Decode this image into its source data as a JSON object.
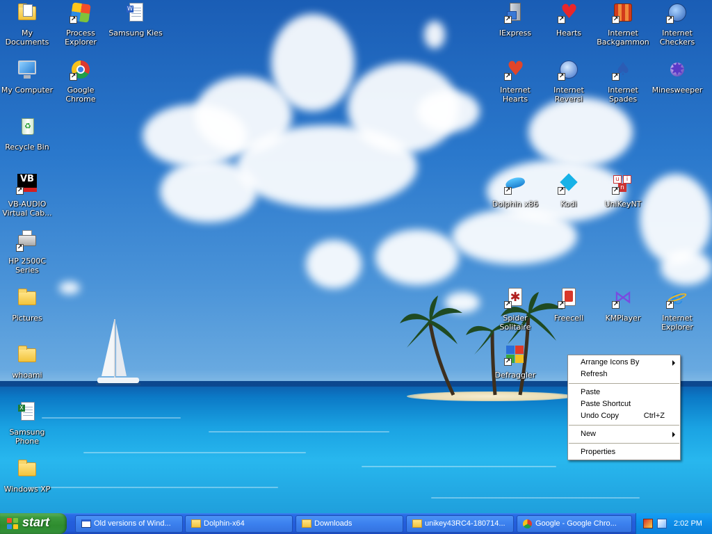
{
  "desktop": {
    "icons": [
      {
        "label": "My Documents",
        "icon": "folder-documents-icon",
        "shortcut": false
      },
      {
        "label": "Process Explorer",
        "icon": "process-explorer-icon",
        "shortcut": true
      },
      {
        "label": "Samsung Kies",
        "icon": "document-icon",
        "shortcut": false
      },
      {
        "label": "My Computer",
        "icon": "computer-icon",
        "shortcut": false
      },
      {
        "label": "Google Chrome",
        "icon": "chrome-icon",
        "shortcut": true
      },
      {
        "label": "Recycle Bin",
        "icon": "recycle-bin-icon",
        "shortcut": false
      },
      {
        "label": "VB-AUDIO Virtual Cab...",
        "icon": "vb-audio-icon",
        "shortcut": true
      },
      {
        "label": "HP 2500C Series",
        "icon": "printer-icon",
        "shortcut": true
      },
      {
        "label": "Pictures",
        "icon": "folder-icon",
        "shortcut": false
      },
      {
        "label": "whoami",
        "icon": "folder-icon",
        "shortcut": false
      },
      {
        "label": "Samsung Phone",
        "icon": "spreadsheet-icon",
        "shortcut": false
      },
      {
        "label": "Windows XP",
        "icon": "folder-icon",
        "shortcut": false
      },
      {
        "label": "IExpress",
        "icon": "iexpress-icon",
        "shortcut": true
      },
      {
        "label": "Hearts",
        "icon": "hearts-icon",
        "shortcut": true
      },
      {
        "label": "Internet Backgammon",
        "icon": "backgammon-icon",
        "shortcut": true
      },
      {
        "label": "Internet Checkers",
        "icon": "checkers-icon",
        "shortcut": true
      },
      {
        "label": "Internet Hearts",
        "icon": "internet-hearts-icon",
        "shortcut": true
      },
      {
        "label": "Internet Reversi",
        "icon": "reversi-icon",
        "shortcut": true
      },
      {
        "label": "Internet Spades",
        "icon": "spades-icon",
        "shortcut": true
      },
      {
        "label": "Minesweeper",
        "icon": "minesweeper-icon",
        "shortcut": false
      },
      {
        "label": "Dolphin x86",
        "icon": "dolphin-icon",
        "shortcut": true
      },
      {
        "label": "Kodi",
        "icon": "kodi-icon",
        "shortcut": true
      },
      {
        "label": "UniKeyNT",
        "icon": "unikey-icon",
        "shortcut": true
      },
      {
        "label": "Spider Solitaire",
        "icon": "spider-solitaire-icon",
        "shortcut": true
      },
      {
        "label": "Freecell",
        "icon": "freecell-icon",
        "shortcut": true
      },
      {
        "label": "KMPlayer",
        "icon": "kmplayer-icon",
        "shortcut": true
      },
      {
        "label": "Internet Explorer",
        "icon": "internet-explorer-icon",
        "shortcut": true
      },
      {
        "label": "Defraggler",
        "icon": "defraggler-icon",
        "shortcut": true
      }
    ]
  },
  "context_menu": {
    "arrange_icons_by": "Arrange Icons By",
    "refresh": "Refresh",
    "paste": "Paste",
    "paste_shortcut": "Paste Shortcut",
    "undo_copy": "Undo Copy",
    "undo_copy_shortcut": "Ctrl+Z",
    "new": "New",
    "properties": "Properties"
  },
  "taskbar": {
    "start_label": "start",
    "tasks": [
      {
        "label": "Old versions of Wind...",
        "icon": "browser-window-icon"
      },
      {
        "label": "Dolphin-x64",
        "icon": "folder-icon"
      },
      {
        "label": "Downloads",
        "icon": "folder-icon"
      },
      {
        "label": "unikey43RC4-180714...",
        "icon": "folder-icon"
      },
      {
        "label": "Google - Google Chro...",
        "icon": "chrome-icon"
      }
    ],
    "clock": "2:02 PM"
  },
  "colors": {
    "taskbar_blue": "#245edb",
    "start_green": "#3c9a3c",
    "tray_blue": "#0d8ce8"
  }
}
